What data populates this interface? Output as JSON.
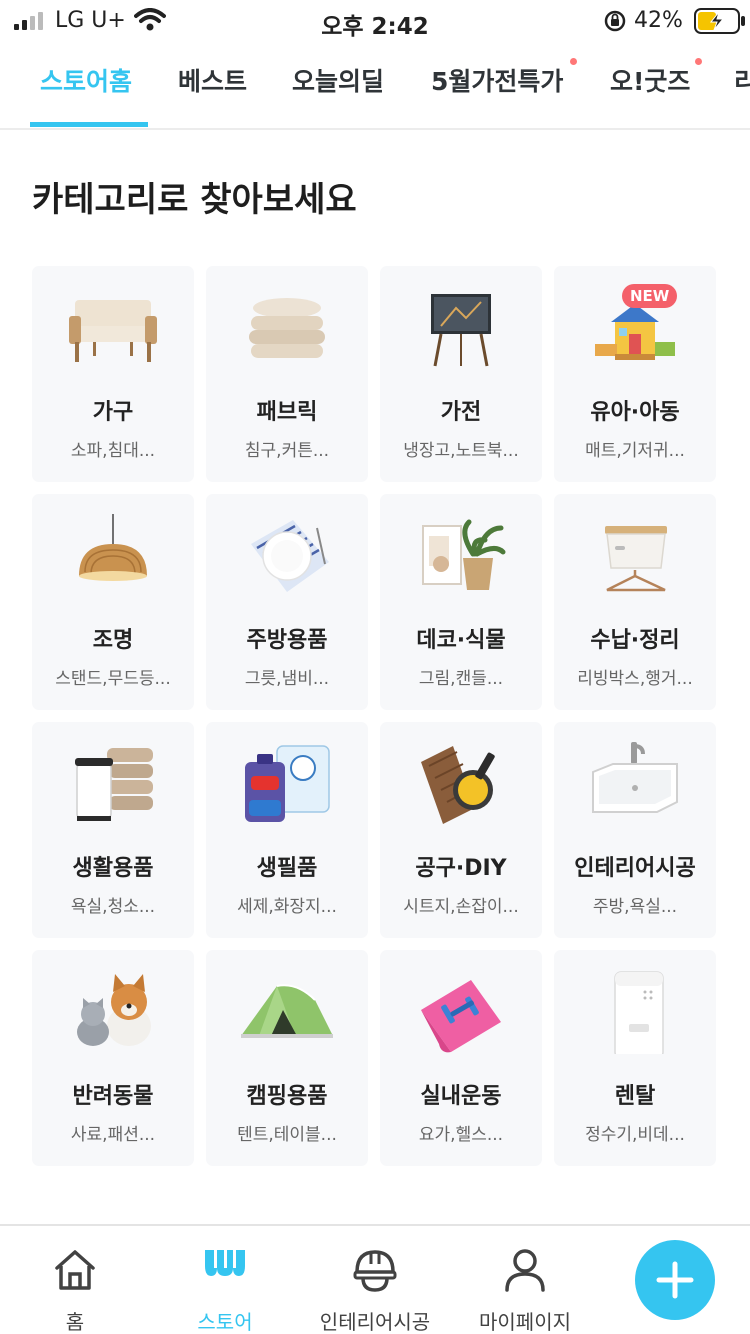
{
  "status_bar": {
    "carrier": "LG U+",
    "time": "오후 2:42",
    "battery_percent": "42%",
    "signal_level": 2,
    "battery_level": 0.42
  },
  "top_tabs": [
    {
      "label": "스토어홈",
      "active": true,
      "dot": false
    },
    {
      "label": "베스트",
      "active": false,
      "dot": false
    },
    {
      "label": "오늘의딜",
      "active": false,
      "dot": false
    },
    {
      "label": "5월가전특가",
      "active": false,
      "dot": true
    },
    {
      "label": "오!굿즈",
      "active": false,
      "dot": true
    },
    {
      "label": "리",
      "active": false,
      "dot": false
    }
  ],
  "section_title": "카테고리로 찾아보세요",
  "categories": [
    {
      "name": "가구",
      "sub": "소파,침대...",
      "icon": "sofa-icon"
    },
    {
      "name": "패브릭",
      "sub": "침구,커튼...",
      "icon": "bedding-icon"
    },
    {
      "name": "가전",
      "sub": "냉장고,노트북...",
      "icon": "tv-icon"
    },
    {
      "name": "유아·아동",
      "sub": "매트,기저귀...",
      "icon": "playhouse-icon",
      "badge": "NEW"
    },
    {
      "name": "조명",
      "sub": "스탠드,무드등...",
      "icon": "pendant-lamp-icon"
    },
    {
      "name": "주방용품",
      "sub": "그릇,냄비...",
      "icon": "plate-icon"
    },
    {
      "name": "데코·식물",
      "sub": "그림,캔들...",
      "icon": "plant-icon"
    },
    {
      "name": "수납·정리",
      "sub": "리빙박스,행거...",
      "icon": "storage-box-icon"
    },
    {
      "name": "생활용품",
      "sub": "욕실,청소...",
      "icon": "trash-bin-icon"
    },
    {
      "name": "생필품",
      "sub": "세제,화장지...",
      "icon": "detergent-icon"
    },
    {
      "name": "공구·DIY",
      "sub": "시트지,손잡이...",
      "icon": "paint-tools-icon"
    },
    {
      "name": "인테리어시공",
      "sub": "주방,욕실...",
      "icon": "sink-icon"
    },
    {
      "name": "반려동물",
      "sub": "사료,패션...",
      "icon": "pets-icon"
    },
    {
      "name": "캠핑용품",
      "sub": "텐트,테이블...",
      "icon": "tent-icon"
    },
    {
      "name": "실내운동",
      "sub": "요가,헬스...",
      "icon": "yoga-mat-icon"
    },
    {
      "name": "렌탈",
      "sub": "정수기,비데...",
      "icon": "water-purifier-icon"
    }
  ],
  "bottom_nav": [
    {
      "label": "홈",
      "icon": "home-icon",
      "active": false
    },
    {
      "label": "스토어",
      "icon": "store-icon",
      "active": true
    },
    {
      "label": "인테리어시공",
      "icon": "helmet-icon",
      "active": false
    },
    {
      "label": "마이페이지",
      "icon": "person-icon",
      "active": false
    }
  ],
  "fab": {
    "icon": "plus-icon"
  },
  "colors": {
    "accent": "#35c5f0",
    "badge": "#f4606a",
    "card_bg": "#f7f8fa"
  }
}
